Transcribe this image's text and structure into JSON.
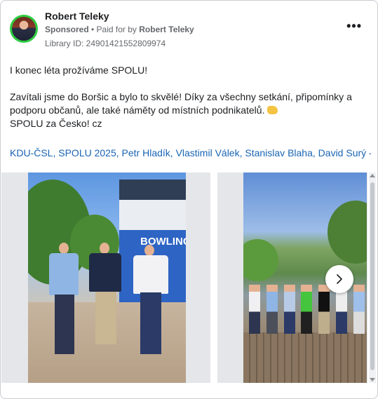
{
  "advertiser": {
    "name": "Robert Teleky",
    "sponsored_label": "Sponsored",
    "paid_for_prefix": "• Paid for by",
    "paid_for_by": "Robert Teleky",
    "library_id": "Library ID: 24901421552809974"
  },
  "menu_icon": "more-horizontal-icon",
  "post": {
    "line1": "I konec léta prožíváme SPOLU!",
    "line2": "Zavítali jsme do Boršic a bylo to skvělé! Díky za všechny setkání, připomínky a podporu občanů, ale také náměty od místních podnikatelů.",
    "emoji_icon": "handshake-emoji-icon",
    "line3": "SPOLU za Česko! cz"
  },
  "hashtags": {
    "tag1": "KDU-ČSL",
    "tag2": "SPOLU 2025",
    "tag3": "Petr Hladík",
    "tag4": "Vlastimil Válek",
    "tag5": "Stanislav Blaha",
    "tag6": "David Surý -..."
  },
  "carousel": {
    "slide1_building_text": "BOWLING",
    "next_icon": "chevron-right-icon"
  },
  "colors": {
    "link": "#1a65b4",
    "secondary_text": "#65676b",
    "avatar_ring": "#2ecc40"
  }
}
